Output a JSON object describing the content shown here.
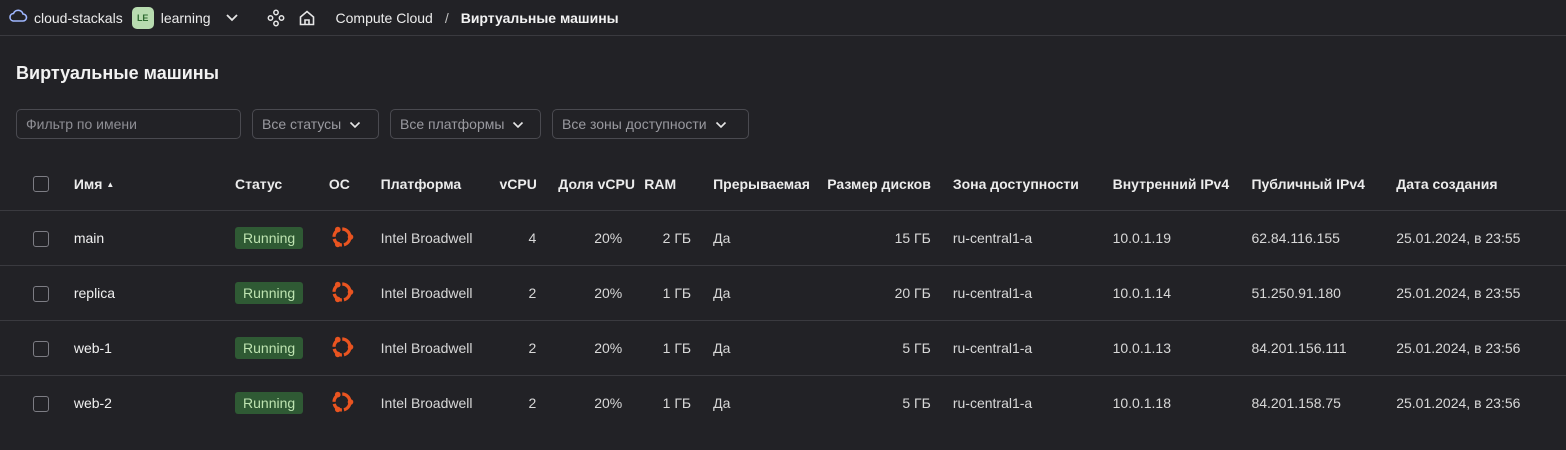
{
  "topbar": {
    "cloud_name": "cloud-stackals",
    "folder_badge": "LE",
    "folder_name": "learning",
    "breadcrumb_service": "Compute Cloud",
    "breadcrumb_separator": "/",
    "breadcrumb_current": "Виртуальные машины"
  },
  "page_title": "Виртуальные машины",
  "filters": {
    "name_placeholder": "Фильтр по имени",
    "status": "Все статусы",
    "platform": "Все платформы",
    "zone": "Все зоны доступности"
  },
  "columns": {
    "name": "Имя",
    "status": "Статус",
    "os": "ОС",
    "platform": "Платформа",
    "vcpu": "vCPU",
    "vcpu_share": "Доля vCPU",
    "ram": "RAM",
    "preemptible": "Прерываемая",
    "disk_size": "Размер дисков",
    "zone": "Зона доступности",
    "internal_ip": "Внутренний IPv4",
    "public_ip": "Публичный IPv4",
    "created": "Дата создания"
  },
  "rows": [
    {
      "name": "main",
      "status": "Running",
      "os_icon": "ubuntu-icon",
      "platform": "Intel Broadwell",
      "vcpu": "4",
      "vcpu_share": "20%",
      "ram": "2 ГБ",
      "preemptible": "Да",
      "disk_size": "15 ГБ",
      "zone": "ru-central1-a",
      "internal_ip": "10.0.1.19",
      "public_ip": "62.84.116.155",
      "created": "25.01.2024, в 23:55"
    },
    {
      "name": "replica",
      "status": "Running",
      "os_icon": "ubuntu-icon",
      "platform": "Intel Broadwell",
      "vcpu": "2",
      "vcpu_share": "20%",
      "ram": "1 ГБ",
      "preemptible": "Да",
      "disk_size": "20 ГБ",
      "zone": "ru-central1-a",
      "internal_ip": "10.0.1.14",
      "public_ip": "51.250.91.180",
      "created": "25.01.2024, в 23:55"
    },
    {
      "name": "web-1",
      "status": "Running",
      "os_icon": "ubuntu-icon",
      "platform": "Intel Broadwell",
      "vcpu": "2",
      "vcpu_share": "20%",
      "ram": "1 ГБ",
      "preemptible": "Да",
      "disk_size": "5 ГБ",
      "zone": "ru-central1-a",
      "internal_ip": "10.0.1.13",
      "public_ip": "84.201.156.111",
      "created": "25.01.2024, в 23:56"
    },
    {
      "name": "web-2",
      "status": "Running",
      "os_icon": "ubuntu-icon",
      "platform": "Intel Broadwell",
      "vcpu": "2",
      "vcpu_share": "20%",
      "ram": "1 ГБ",
      "preemptible": "Да",
      "disk_size": "5 ГБ",
      "zone": "ru-central1-a",
      "internal_ip": "10.0.1.18",
      "public_ip": "84.201.158.75",
      "created": "25.01.2024, в 23:56"
    }
  ],
  "colors": {
    "background": "#222226",
    "status_running_bg": "#2f5a34",
    "ubuntu_orange": "#e95420"
  }
}
